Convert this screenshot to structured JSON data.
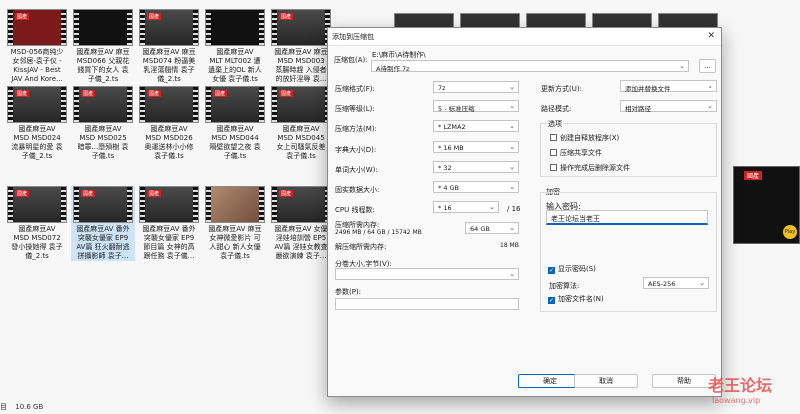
{
  "explorer": {
    "thumbnails": [
      {
        "label": "MSD-056商纯少\n女邻居-袁子仪 -\nKissJAV - Best\nJAV And Kore...",
        "style": "red",
        "tag": "國產"
      },
      {
        "label": "國產麻豆AV 麻豆\nMSD066 父親花\n錢買下的女人 袁\n子儀_2.ts",
        "style": "dark",
        "tag": ""
      },
      {
        "label": "國產麻豆AV 麻豆\nMSD074 粉逼美\n乳淫蕩翹情 袁子\n儀_2.ts",
        "style": "grey",
        "tag": "國產"
      },
      {
        "label": "國產麻豆AV\nMLT MLT002 遭\n遺棄上的OL 新人\n女優 袁子儀.ts",
        "style": "dark",
        "tag": ""
      },
      {
        "label": "國產麻豆AV 麻豆\nMSD MSD003\n蒸腸時趕 入侵者\n的放奸淫辱 袁...",
        "style": "grey",
        "tag": "國產"
      },
      {
        "label": "國產麻豆AV\nMSD MSD024\n流暴明星的愛 袁\n子儀_2.ts",
        "style": "grey",
        "tag": "國產"
      },
      {
        "label": "國產麻豆AV\nMSD MSD025\n暗罪...墮殞樹 袁\n子儀.ts",
        "style": "grey",
        "tag": "國產"
      },
      {
        "label": "國產麻豆AV\nMSD MSD026\n奥運送林小小修\n袁子儀.ts",
        "style": "grey",
        "tag": "國產"
      },
      {
        "label": "國產麻豆AV\nMSD MSD044\n隔壁欲望之夜 袁\n子儀.ts",
        "style": "grey",
        "tag": "國產"
      },
      {
        "label": "國產麻豆AV\nMSD MSD045\n女上司騷氣反差\n袁子儀.ts",
        "style": "grey",
        "tag": "國產"
      },
      {
        "label": "國產麻豆AV\nMSD MSD072\n發小操她得 袁子\n儀_2.ts",
        "style": "grey",
        "tag": "國產"
      },
      {
        "label": "國產麻豆AV 番外\n突襲女優家 EP9\nAV篇 狂火翻耐逃\n拼攝影師 袁子...",
        "style": "grey",
        "tag": "國產"
      },
      {
        "label": "國產麻豆AV 番外\n突襲女優家 EP9\n節目篇 女神的高\n跟任務 袁子儀...",
        "style": "grey",
        "tag": "國產"
      },
      {
        "label": "國產麻豆AV 麻豆\n女神微愛影片 可\n人甜心 新人女優\n袁子儀.ts",
        "style": "pic",
        "tag": ""
      },
      {
        "label": "國產麻豆AV 女優\n淫娃培訓營 EP5\nAV篇 淫娃女教查\n嚴欲演練 袁子...",
        "style": "grey",
        "tag": "國產"
      }
    ],
    "status_left": "目",
    "status_size": "10.6 GB",
    "right_thumb_tag": "國產",
    "right_thumb_play": "Play"
  },
  "dialog": {
    "title": "添加到压缩包",
    "close": "✕",
    "archive_label": "压缩包(A):",
    "archive_path": "E:\\麻币\\A待制作\\",
    "archive_name": "A待制作.7z",
    "browse_button": "...",
    "format_label": "压缩格式(F):",
    "format_value": "7z",
    "level_label": "压缩等级(L):",
    "level_value": "5 - 标准压缩",
    "method_label": "压缩方法(M):",
    "method_value": "* LZMA2",
    "dict_label": "字典大小(D):",
    "dict_value": "* 16 MB",
    "word_label": "单词大小(W):",
    "word_value": "* 32",
    "solid_label": "固实数据大小:",
    "solid_value": "* 4 GB",
    "threads_label": "CPU 线程数:",
    "threads_value": "* 16",
    "threads_total": "/ 16",
    "mem_comp_label": "压缩所需内存:",
    "mem_comp_value": "2496 MB / 64 GB / 15742 MB",
    "mem_comp_select": "64 GB",
    "mem_decomp_label": "解压缩所需内存:",
    "mem_decomp_value": "18 MB",
    "split_label": "分卷大小,字节(V):",
    "params_label": "参数(P):",
    "update_label": "更新方式(U):",
    "update_value": "添加并替换文件",
    "path_label": "路径模式:",
    "path_value": "相对路径",
    "options_title": "选项",
    "opt_symlinks": "创建自释放程序(X)",
    "opt_shared": "压缩共享文件",
    "opt_delete": "操作完成后删除源文件",
    "encrypt_title": "加密",
    "password_label": "输入密码:",
    "password_value": "老王论坛当老王",
    "show_password": "显示密码(S)",
    "enc_method_label": "加密算法:",
    "enc_method_value": "AES-256",
    "encrypt_names": "加密文件名(N)",
    "ok": "确定",
    "cancel": "取消",
    "help": "帮助"
  },
  "watermark": {
    "text": "老王论坛",
    "url": "laowang.vip"
  }
}
